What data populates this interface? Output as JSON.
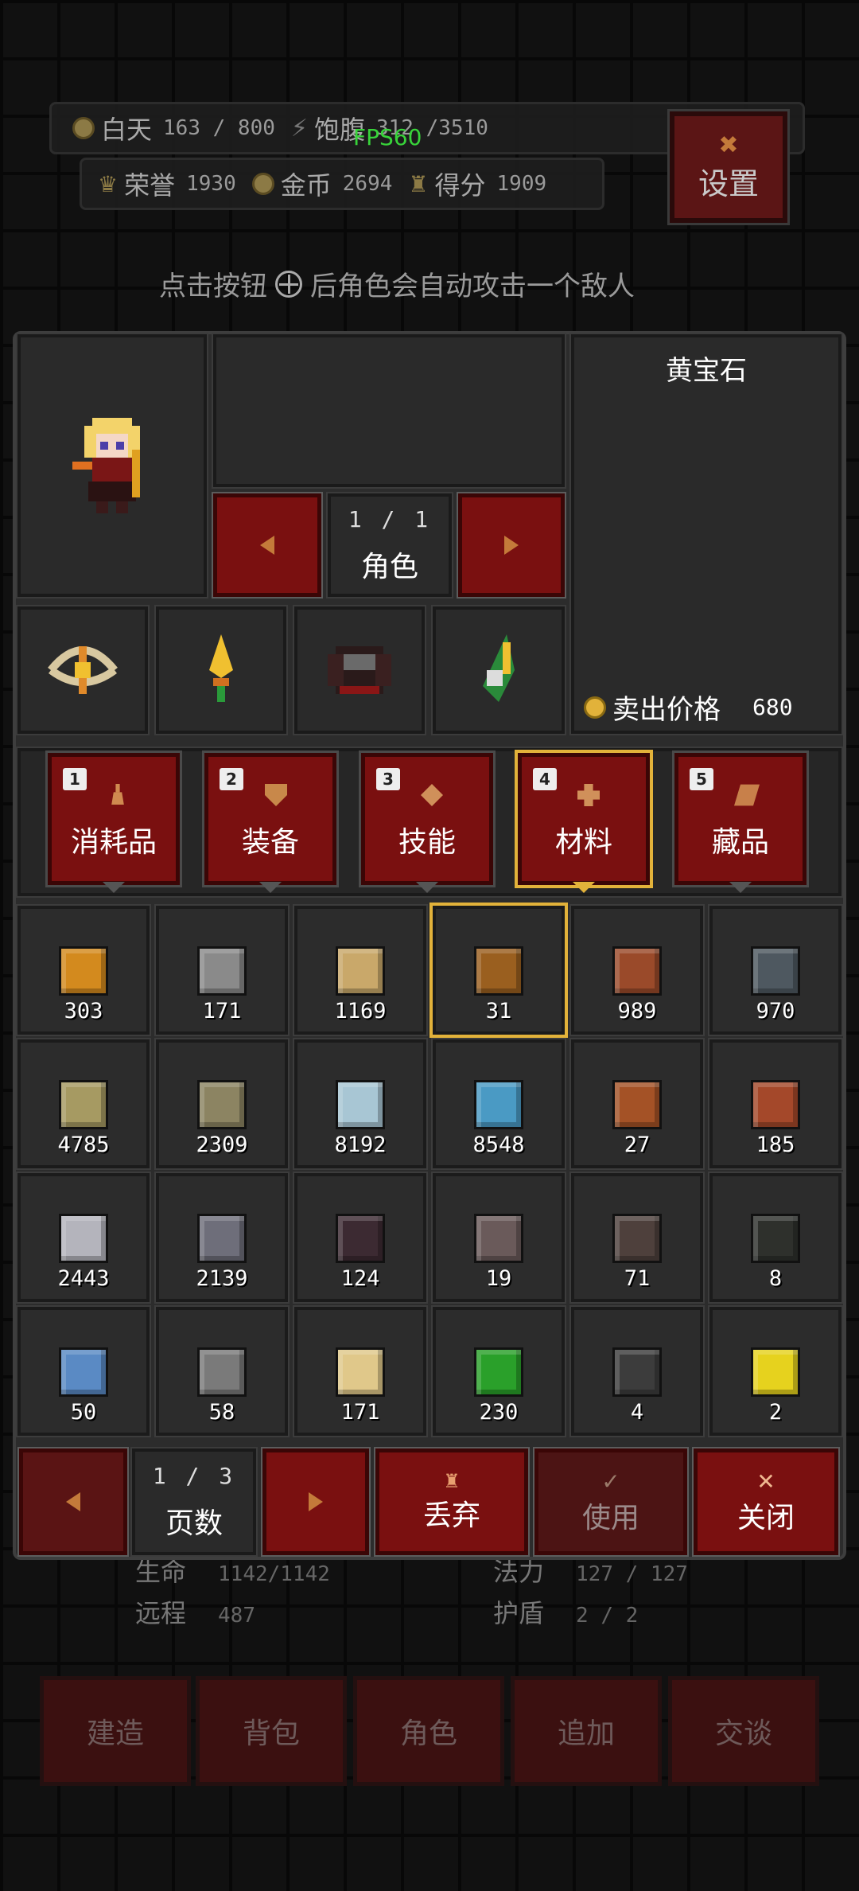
{
  "hud": {
    "day_label": "白天",
    "day_value": "163 / 800",
    "hunger_label": "饱腹",
    "hunger_value": "312 /3510",
    "honor_label": "荣誉",
    "honor_value": "1930",
    "gold_label": "金币",
    "gold_value": "2694",
    "score_label": "得分",
    "score_value": "1909",
    "fps": "FPS60",
    "settings": "设置",
    "hint_before": "点击按钮",
    "hint_after": "后角色会自动攻击一个敌人"
  },
  "character": {
    "pager": "1 / 1",
    "pager_label": "角色",
    "equipment_icons": [
      "bow-icon",
      "dagger-icon",
      "armor-icon",
      "boots-icon"
    ]
  },
  "detail": {
    "item_name": "黄宝石",
    "sell_label": "卖出价格",
    "sell_price": "680"
  },
  "tabs": [
    {
      "num": "1",
      "label": "消耗品",
      "icon": "potion-icon"
    },
    {
      "num": "2",
      "label": "装备",
      "icon": "shield-icon"
    },
    {
      "num": "3",
      "label": "技能",
      "icon": "diamond-icon"
    },
    {
      "num": "4",
      "label": "材料",
      "icon": "material-icon",
      "active": true
    },
    {
      "num": "5",
      "label": "藏品",
      "icon": "collection-icon"
    }
  ],
  "inventory": [
    {
      "icon": "amber-ore-icon",
      "count": "303",
      "color": "#d38a1e"
    },
    {
      "icon": "iron-ingot-icon",
      "count": "171",
      "color": "#8a8a8a"
    },
    {
      "icon": "crystal-cluster-icon",
      "count": "1169",
      "color": "#c9a86a"
    },
    {
      "icon": "topaz-gem-icon",
      "count": "31",
      "color": "#9a5f1f",
      "selected": true
    },
    {
      "icon": "copper-block-icon",
      "count": "989",
      "color": "#9a4a2a"
    },
    {
      "icon": "slate-block-icon",
      "count": "970",
      "color": "#4e5860"
    },
    {
      "icon": "sandstone-block-icon",
      "count": "4785",
      "color": "#a69a62"
    },
    {
      "icon": "mossy-stone-icon",
      "count": "2309",
      "color": "#8c8462"
    },
    {
      "icon": "glass-block-icon",
      "count": "8192",
      "color": "#a8c6d4"
    },
    {
      "icon": "ice-block-icon",
      "count": "8548",
      "color": "#4a9ac4"
    },
    {
      "icon": "cracked-copper-icon",
      "count": "27",
      "color": "#a45226"
    },
    {
      "icon": "rust-block-icon",
      "count": "185",
      "color": "#a4482a"
    },
    {
      "icon": "marble-block-icon",
      "count": "2443",
      "color": "#b4b4bc"
    },
    {
      "icon": "steel-block-icon",
      "count": "2139",
      "color": "#6e6e7a"
    },
    {
      "icon": "obsidian-block-icon",
      "count": "124",
      "color": "#3c2a32"
    },
    {
      "icon": "granite-block-icon",
      "count": "19",
      "color": "#6a5a5a"
    },
    {
      "icon": "basalt-block-icon",
      "count": "71",
      "color": "#4e403c"
    },
    {
      "icon": "dark-brick-icon",
      "count": "8",
      "color": "#2e302c"
    },
    {
      "icon": "blue-glass-icon",
      "count": "50",
      "color": "#5a8ac4"
    },
    {
      "icon": "jar-icon",
      "count": "58",
      "color": "#7a7a7a"
    },
    {
      "icon": "star-shard-icon",
      "count": "171",
      "color": "#e0c88a"
    },
    {
      "icon": "emerald-cube-icon",
      "count": "230",
      "color": "#2aa02a"
    },
    {
      "icon": "coal-cube-icon",
      "count": "4",
      "color": "#3c3c3c"
    },
    {
      "icon": "gold-cube-icon",
      "count": "2",
      "color": "#e6d21e"
    }
  ],
  "footer": {
    "pager": "1 / 3",
    "pager_label": "页数",
    "discard": "丢弃",
    "use": "使用",
    "close": "关闭"
  },
  "background": {
    "hp_label": "生命",
    "hp_value": "1142/1142",
    "mp_label": "法力",
    "mp_value": "127 / 127",
    "range_label": "远程",
    "range_value": "487",
    "shield_label": "护盾",
    "shield_value": "2 / 2",
    "nav": [
      "建造",
      "背包",
      "角色",
      "追加",
      "交谈"
    ]
  }
}
